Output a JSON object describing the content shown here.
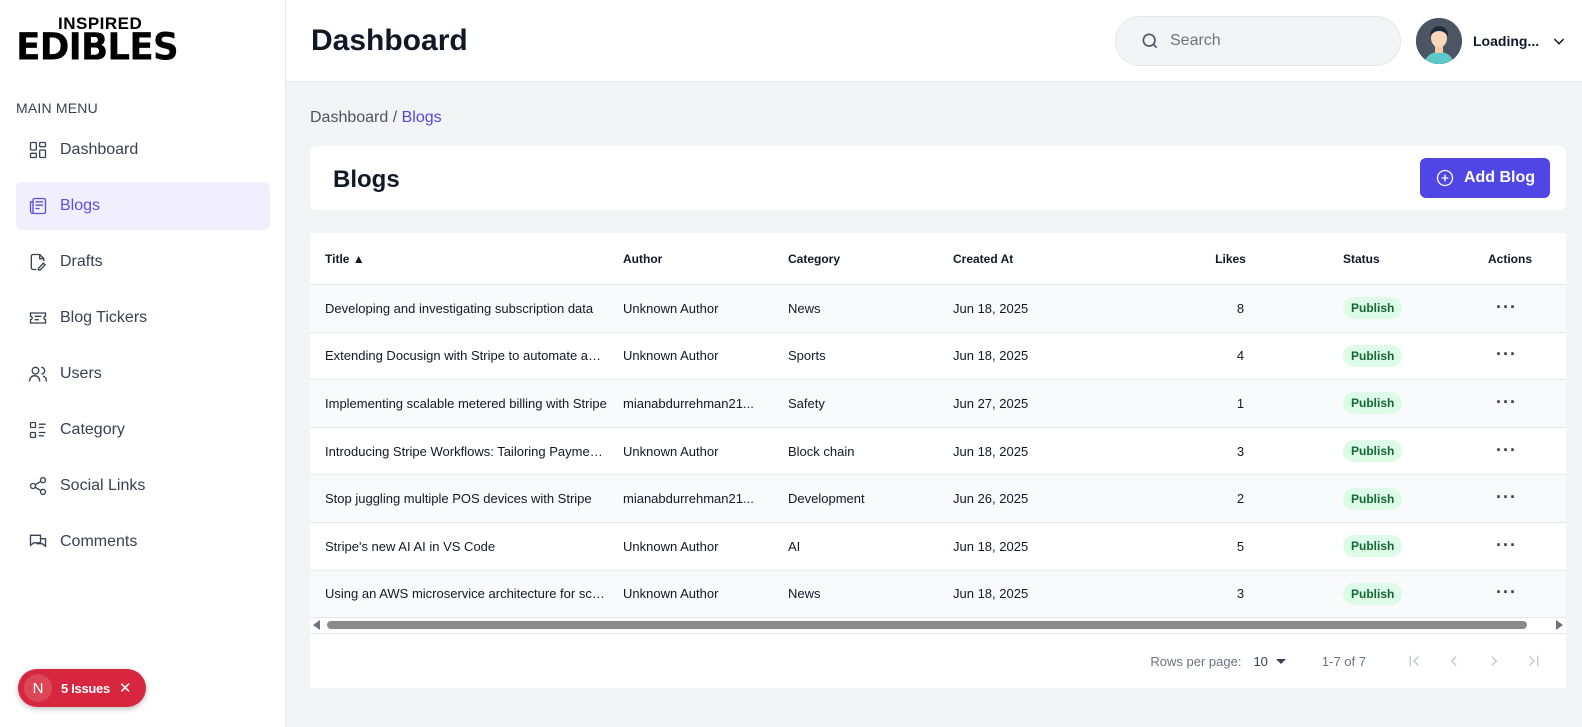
{
  "brand": {
    "top": "INSPIRED",
    "main": "EDIBLES"
  },
  "sidebar": {
    "menu_label": "MAIN MENU",
    "items": [
      {
        "label": "Dashboard",
        "icon": "dashboard-grid-icon",
        "active": false
      },
      {
        "label": "Blogs",
        "icon": "newspaper-icon",
        "active": true
      },
      {
        "label": "Drafts",
        "icon": "file-edit-icon",
        "active": false
      },
      {
        "label": "Blog Tickers",
        "icon": "ticket-icon",
        "active": false
      },
      {
        "label": "Users",
        "icon": "users-icon",
        "active": false
      },
      {
        "label": "Category",
        "icon": "list-icon",
        "active": false
      },
      {
        "label": "Social Links",
        "icon": "share-icon",
        "active": false
      },
      {
        "label": "Comments",
        "icon": "comments-icon",
        "active": false
      }
    ]
  },
  "issues_badge": {
    "letter": "N",
    "label": "5 Issues"
  },
  "header": {
    "title": "Dashboard",
    "search_placeholder": "Search",
    "user_name": "Loading..."
  },
  "breadcrumb": {
    "root": "Dashboard /",
    "current": "Blogs"
  },
  "page": {
    "title": "Blogs",
    "add_label": "Add Blog"
  },
  "table": {
    "columns": [
      "Title ▲",
      "Author",
      "Category",
      "Created At",
      "Likes",
      "Status",
      "Actions"
    ],
    "rows": [
      {
        "title": "Developing and investigating subscription data",
        "author": "Unknown Author",
        "category": "News",
        "created": "Jun 18, 2025",
        "likes": "8",
        "status": "Publish"
      },
      {
        "title": "Extending Docusign with Stripe to automate agreements",
        "author": "Unknown Author",
        "category": "Sports",
        "created": "Jun 18, 2025",
        "likes": "4",
        "status": "Publish"
      },
      {
        "title": "Implementing scalable metered billing with Stripe",
        "author": "mianabdurrehman21...",
        "category": "Safety",
        "created": "Jun 27, 2025",
        "likes": "1",
        "status": "Publish"
      },
      {
        "title": "Introducing Stripe Workflows: Tailoring Payments",
        "author": "Unknown Author",
        "category": "Block chain",
        "created": "Jun 18, 2025",
        "likes": "3",
        "status": "Publish"
      },
      {
        "title": "Stop juggling multiple POS devices with Stripe",
        "author": "mianabdurrehman21...",
        "category": "Development",
        "created": "Jun 26, 2025",
        "likes": "2",
        "status": "Publish"
      },
      {
        "title": "Stripe's new AI AI in VS Code",
        "author": "Unknown Author",
        "category": "AI",
        "created": "Jun 18, 2025",
        "likes": "5",
        "status": "Publish"
      },
      {
        "title": "Using an AWS microservice architecture for scale",
        "author": "Unknown Author",
        "category": "News",
        "created": "Jun 18, 2025",
        "likes": "3",
        "status": "Publish"
      }
    ],
    "actions_glyph": "···"
  },
  "pagination": {
    "rows_label": "Rows per page:",
    "rows_value": "10",
    "range": "1-7 of 7"
  },
  "colors": {
    "accent": "#4f46e5",
    "badge_bg": "#dcfce7",
    "badge_text": "#166534",
    "issues": "#d7263d"
  }
}
